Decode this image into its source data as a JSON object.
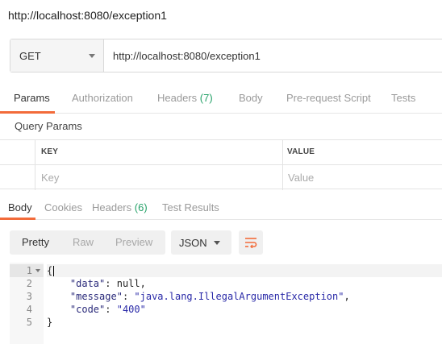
{
  "window_title": "http://localhost:8080/exception1",
  "request": {
    "method": "GET",
    "url": "http://localhost:8080/exception1"
  },
  "request_tabs": [
    {
      "label": "Params"
    },
    {
      "label": "Authorization"
    },
    {
      "label": "Headers",
      "count": "(7)"
    },
    {
      "label": "Body"
    },
    {
      "label": "Pre-request Script"
    },
    {
      "label": "Tests"
    }
  ],
  "query_params": {
    "title": "Query Params",
    "columns": [
      "KEY",
      "VALUE"
    ],
    "placeholders": {
      "key": "Key",
      "value": "Value"
    }
  },
  "response_tabs": [
    {
      "label": "Body"
    },
    {
      "label": "Cookies"
    },
    {
      "label": "Headers",
      "count": "(6)"
    },
    {
      "label": "Test Results"
    }
  ],
  "format_buttons": [
    "Pretty",
    "Raw",
    "Preview"
  ],
  "language": "JSON",
  "icons": {
    "method_caret": "chevron-down-icon",
    "language_caret": "chevron-down-icon",
    "wrap": "wrap-lines-icon",
    "fold": "fold-arrow-icon"
  },
  "colors": {
    "accent": "#f26b3a",
    "count": "#26a269"
  },
  "response_body": {
    "line_numbers": [
      "1",
      "2",
      "3",
      "4",
      "5"
    ],
    "open_brace": "{",
    "fields": [
      {
        "key": "\"data\"",
        "sep": ": ",
        "value": "null",
        "suffix": ","
      },
      {
        "key": "\"message\"",
        "sep": ": ",
        "value": "\"java.lang.IllegalArgumentException\"",
        "suffix": ","
      },
      {
        "key": "\"code\"",
        "sep": ": ",
        "value": "\"400\"",
        "suffix": ""
      }
    ],
    "close_brace": "}"
  }
}
